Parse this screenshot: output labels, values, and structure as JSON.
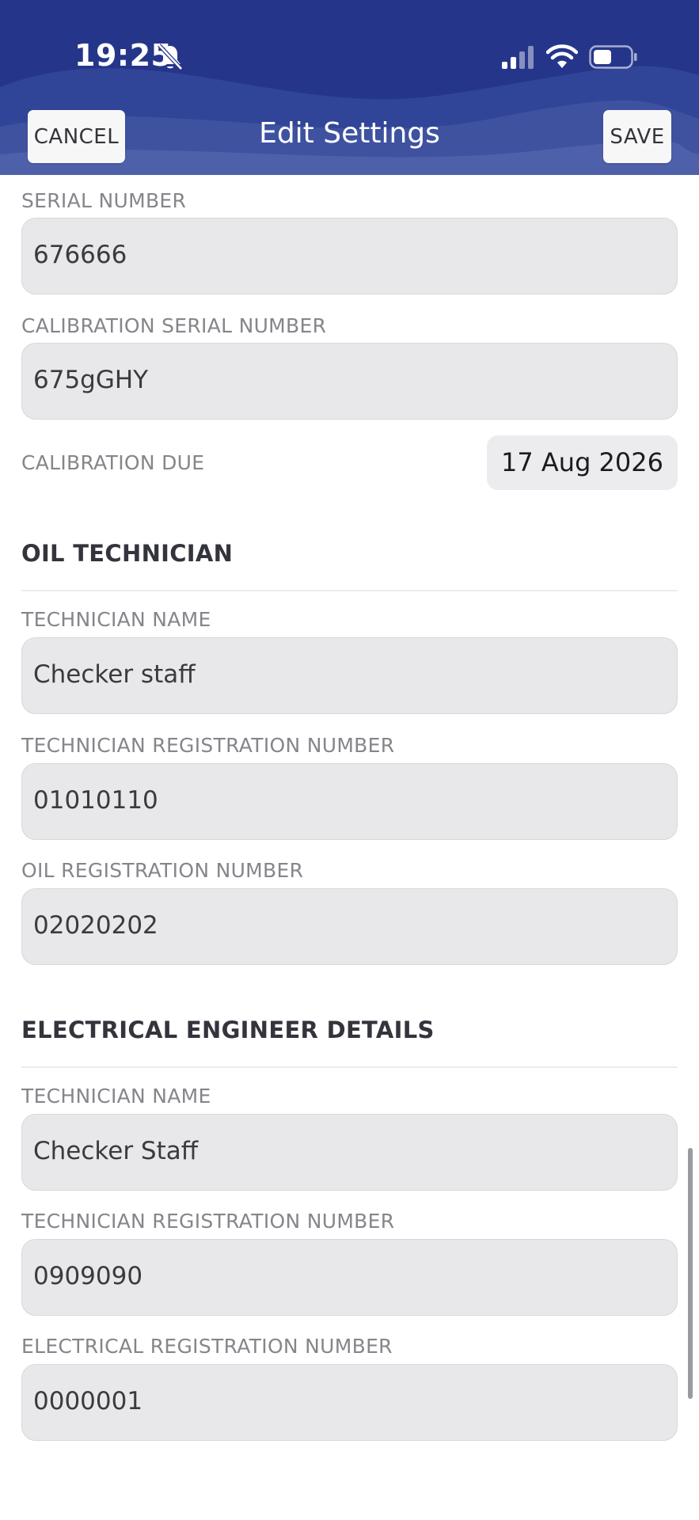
{
  "status_bar": {
    "time": "19:25"
  },
  "header": {
    "title": "Edit Settings",
    "cancel_label": "CANCEL",
    "save_label": "SAVE"
  },
  "equipment": {
    "serial_number_label": "SERIAL NUMBER",
    "serial_number_value": "676666",
    "calibration_serial_label": "CALIBRATION SERIAL NUMBER",
    "calibration_serial_value": "675gGHY",
    "calibration_due_label": "CALIBRATION DUE",
    "calibration_due_value": "17 Aug 2026"
  },
  "oil_technician": {
    "heading": "OIL TECHNICIAN",
    "name_label": "TECHNICIAN NAME",
    "name_value": "Checker staff",
    "tech_reg_label": "TECHNICIAN REGISTRATION NUMBER",
    "tech_reg_value": "01010110",
    "oil_reg_label": "OIL REGISTRATION NUMBER",
    "oil_reg_value": "02020202"
  },
  "electrical_engineer": {
    "heading": "ELECTRICAL ENGINEER DETAILS",
    "name_label": "TECHNICIAN NAME",
    "name_value": "Checker Staff",
    "tech_reg_label": "TECHNICIAN REGISTRATION NUMBER",
    "tech_reg_value": "0909090",
    "elec_reg_label": "ELECTRICAL REGISTRATION NUMBER",
    "elec_reg_value": "0000001"
  },
  "colors": {
    "header_bg": "#25368a",
    "input_bg": "#e8e8ea",
    "label_text": "#85858b"
  }
}
